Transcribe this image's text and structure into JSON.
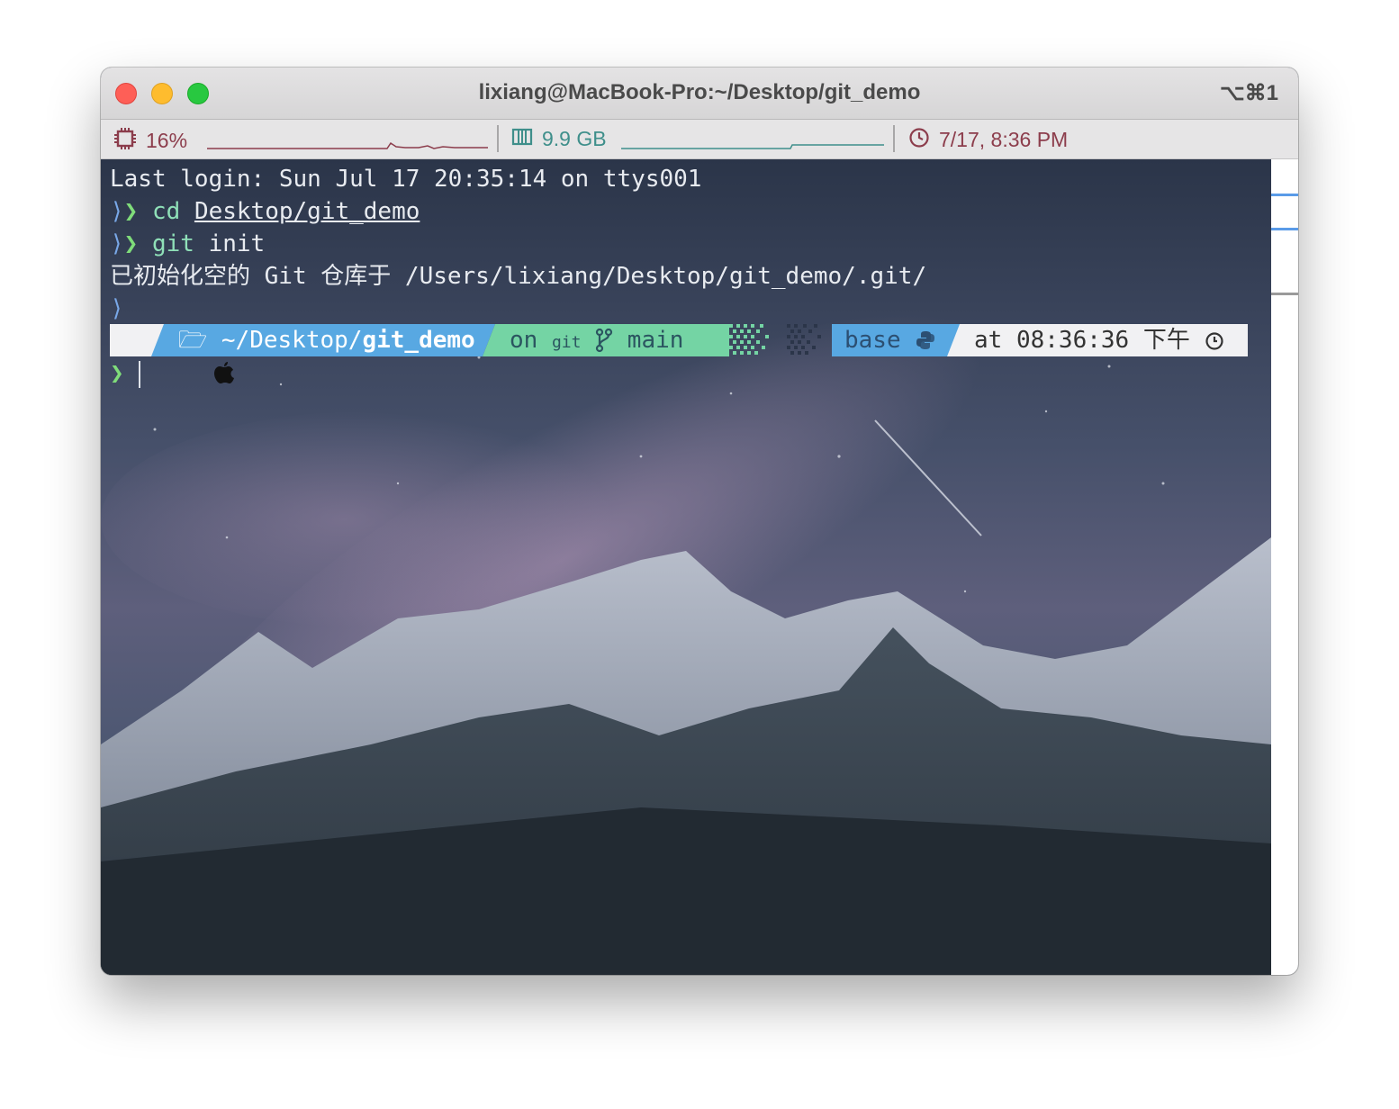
{
  "window": {
    "title": "lixiang@MacBook-Pro:~/Desktop/git_demo",
    "shortcut": "⌥⌘1"
  },
  "statusbar": {
    "cpu": "16%",
    "memory": "9.9 GB",
    "datetime": "7/17, 8:36 PM",
    "cpu_icon": "cpu-chip-icon",
    "memory_icon": "memory-icon",
    "clock_icon": "clock-icon"
  },
  "terminal": {
    "last_login": "Last login: Sun Jul 17 20:35:14 on ttys001",
    "cmd1_name": "cd",
    "cmd1_arg": "Desktop/git_demo",
    "cmd2_name": "git",
    "cmd2_arg": "init",
    "output": "已初始化空的 Git 仓库于 /Users/lixiang/Desktop/git_demo/.git/",
    "prompt_symbol": "❯"
  },
  "prompt": {
    "apple_icon": "apple-icon",
    "folder_icon": "folder-icon",
    "dir_prefix": "~/Desktop/",
    "dir_name": "git_demo",
    "git_on": "on",
    "git_icon": "git",
    "branch_icon": "branch-icon",
    "branch": "main",
    "env": "base",
    "python_icon": "python-icon",
    "time_label": "at 08:36:36 下午",
    "time_icon": "clock-icon"
  },
  "colors": {
    "cpu": "#8c3d4c",
    "memory": "#3f8f8b",
    "prompt_blue": "#58a8e2",
    "prompt_green": "#74d4a4",
    "chevron_green": "#7fdc7a"
  }
}
